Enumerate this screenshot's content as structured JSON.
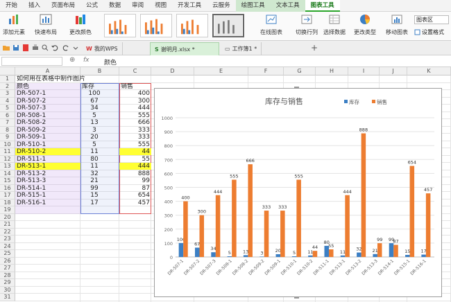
{
  "menubar": {
    "tabs": [
      "开始",
      "插入",
      "页面布局",
      "公式",
      "数据",
      "审阅",
      "视图",
      "开发工具",
      "云服务",
      "绘图工具",
      "文本工具",
      "图表工具"
    ],
    "active": "图表工具"
  },
  "ribbon": {
    "add_element": "添加元素",
    "quick_layout": "快速布局",
    "change_color": "更改颜色",
    "online_chart": "在线图表",
    "switch_rowcol": "切换行列",
    "select_data": "选择数据",
    "change_type": "更改类型",
    "move_chart": "移动图表",
    "chart_area": "图表区",
    "set_format": "设置格式"
  },
  "tabbar": {
    "wps": "我的WPS",
    "file": "谢明月.xlsx *",
    "workbook": "工作簿1 *",
    "new_tab": "+"
  },
  "formula": {
    "fx": "fx",
    "content": "颜色"
  },
  "columns": [
    "A",
    "B",
    "C",
    "D",
    "E",
    "F",
    "G",
    "H",
    "I",
    "J",
    "K"
  ],
  "rows": [
    "1",
    "2",
    "3",
    "4",
    "5",
    "6",
    "7",
    "8",
    "9",
    "10",
    "11",
    "12",
    "13",
    "14",
    "15",
    "16",
    "17",
    "18",
    "19",
    "20",
    "21",
    "22",
    "23",
    "24",
    "25",
    "26",
    "27",
    "28",
    "29",
    "30",
    "31"
  ],
  "sheet": {
    "title": "如何用在表格中制作图片",
    "header": [
      "颜色",
      "库存",
      "销售"
    ],
    "data": [
      [
        "DR-507-1",
        "100",
        "400"
      ],
      [
        "DR-507-2",
        "67",
        "300"
      ],
      [
        "DR-507-3",
        "34",
        "444"
      ],
      [
        "DR-508-1",
        "5",
        "555"
      ],
      [
        "DR-508-2",
        "13",
        "666"
      ],
      [
        "DR-509-2",
        "3",
        "333"
      ],
      [
        "DR-509-1",
        "20",
        "333"
      ],
      [
        "DR-510-1",
        "5",
        "555"
      ],
      [
        "DR-510-2",
        "11",
        "44"
      ],
      [
        "DR-511-1",
        "80",
        "55"
      ],
      [
        "DR-513-1",
        "11",
        "444"
      ],
      [
        "DR-513-2",
        "32",
        "888"
      ],
      [
        "DR-513-3",
        "21",
        "99"
      ],
      [
        "DR-514-1",
        "99",
        "87"
      ],
      [
        "DR-515-1",
        "15",
        "654"
      ],
      [
        "DR-516-1",
        "17",
        "457"
      ]
    ],
    "highlight_rows": [
      8,
      10
    ],
    "highlight_color": "#ffff33"
  },
  "chart_data": {
    "type": "bar",
    "title": "库存与销售",
    "categories": [
      "DR-507-1",
      "DR-507-2",
      "DR-507-3",
      "DR-508-1",
      "DR-508-2",
      "DR-509-2",
      "DR-509-1",
      "DR-510-1",
      "DR-510-2",
      "DR-511-1",
      "DR-513-1",
      "DR-513-2",
      "DR-513-3",
      "DR-514-1",
      "DR-515-1",
      "DR-516-1"
    ],
    "series": [
      {
        "name": "库存",
        "color": "#3c7fc4",
        "values": [
          100,
          67,
          34,
          5,
          13,
          3,
          20,
          5,
          11,
          80,
          11,
          32,
          21,
          99,
          15,
          17
        ]
      },
      {
        "name": "销售",
        "color": "#ed7d31",
        "values": [
          400,
          300,
          444,
          555,
          666,
          333,
          333,
          555,
          44,
          55,
          444,
          888,
          99,
          87,
          654,
          457
        ]
      }
    ],
    "ylim": [
      0,
      1000
    ],
    "yticks": [
      "0",
      "100",
      "200",
      "300",
      "400",
      "500",
      "600",
      "700",
      "800",
      "900",
      "1000"
    ],
    "grid": true,
    "legend": "top-right",
    "data_labels": true
  }
}
